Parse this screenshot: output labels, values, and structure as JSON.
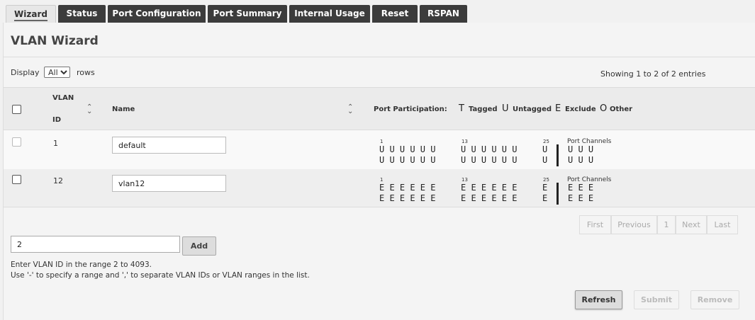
{
  "tabs": [
    {
      "label": "Wizard",
      "active": true
    },
    {
      "label": "Status"
    },
    {
      "label": "Port Configuration"
    },
    {
      "label": "Port Summary"
    },
    {
      "label": "Internal Usage"
    },
    {
      "label": "Reset"
    },
    {
      "label": "RSPAN"
    }
  ],
  "page": {
    "title": "VLAN Wizard"
  },
  "display": {
    "label": "Display",
    "selected": "All",
    "suffix": "rows"
  },
  "showing": "Showing 1 to 2 of 2 entries",
  "table": {
    "col_vlan_line1": "VLAN",
    "col_vlan_line2": "ID",
    "col_name": "Name",
    "col_port": "Port Participation:",
    "legend": [
      {
        "letter": "T",
        "label": "Tagged"
      },
      {
        "letter": "U",
        "label": "Untagged"
      },
      {
        "letter": "E",
        "label": "Exclude"
      },
      {
        "letter": "O",
        "label": "Other"
      }
    ],
    "port_start_1": "1",
    "port_start_13": "13",
    "port_start_25": "25",
    "port_channels_label": "Port Channels",
    "rows": [
      {
        "vlan_id": "1",
        "name": "default",
        "group1": "U U U U U U",
        "group2": "U U U U U U",
        "group3": "U",
        "channels": "U U U"
      },
      {
        "vlan_id": "12",
        "name": "vlan12",
        "group1": "E E E E E E",
        "group2": "E E E E E E",
        "group3": "E",
        "channels": "E E E"
      }
    ]
  },
  "pagination": {
    "first": "First",
    "previous": "Previous",
    "page": "1",
    "next": "Next",
    "last": "Last"
  },
  "add": {
    "value": "2",
    "button": "Add"
  },
  "help": {
    "line1": "Enter VLAN ID in the range 2 to 4093.",
    "line2": "Use '-' to specify a range and ',' to separate VLAN IDs or VLAN ranges in the list."
  },
  "actions": {
    "refresh": "Refresh",
    "submit": "Submit",
    "remove": "Remove"
  }
}
